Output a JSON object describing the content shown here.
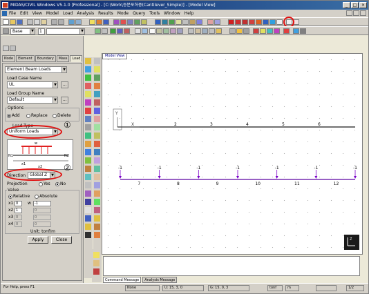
{
  "window": {
    "title": "MIDAS/CIVIL Windows V5.1.0 [Professional] - [C:\\Work\\등분포하중(Cantilever_Simple)] - [Model View]",
    "controls": [
      "_",
      "□",
      "×"
    ]
  },
  "menu": [
    "File",
    "Edit",
    "View",
    "Model",
    "Load",
    "Analysis",
    "Results",
    "Mode",
    "Query",
    "Tools",
    "Window",
    "Help"
  ],
  "toolbar": {
    "unit_system_value": "Base",
    "second_select_value": "1"
  },
  "left_panel": {
    "tabs": [
      "Node",
      "Element",
      "Boundary",
      "Mass",
      "Load"
    ],
    "active_tab": "Load",
    "load_type_select": "Element Beam Loads",
    "load_case_name_label": "Load Case Name",
    "load_case_value": "UL",
    "load_group_name_label": "Load Group Name",
    "load_group_value": "Default",
    "options_label": "Options",
    "options": [
      {
        "label": "Add",
        "selected": true
      },
      {
        "label": "Replace",
        "selected": false
      },
      {
        "label": "Delete",
        "selected": false
      }
    ],
    "load_type_label": "Load Type",
    "load_type_value": "Uniform Loads",
    "diagram_labels": {
      "w": "w",
      "n1": "N1",
      "n2": "N2",
      "x1": "x1",
      "x2": "x2"
    },
    "direction_label": "Direction",
    "direction_value": "Global Z",
    "projection_label": "Projection",
    "projection_options": [
      {
        "label": "Yes",
        "selected": false
      },
      {
        "label": "No",
        "selected": true
      }
    ],
    "value_label": "Value",
    "value_options": [
      {
        "label": "Relative",
        "selected": true
      },
      {
        "label": "Absolute",
        "selected": false
      }
    ],
    "rows": [
      {
        "x": "x1",
        "x_val": "0",
        "w": "w",
        "w_val": "-1"
      },
      {
        "x": "x2",
        "x_val": "1",
        "w": "",
        "w_val": "0"
      },
      {
        "x": "x3",
        "x_val": "0",
        "w": "",
        "w_val": "0"
      },
      {
        "x": "x4",
        "x_val": "0",
        "w": "",
        "w_val": "0"
      }
    ],
    "unit_label": "Unit: tonf/m",
    "apply_label": "Apply",
    "close_label": "Close",
    "annotation_1": "①",
    "annotation_2": "②"
  },
  "model_view": {
    "tab_label": "Model View",
    "top_beam_labels": [
      "1",
      "2",
      "3",
      "4",
      "5",
      "6"
    ],
    "bottom_beam_labels": [
      "7",
      "8",
      "9",
      "10",
      "11",
      "12"
    ],
    "load_marks": [
      "-1",
      "-1",
      "-1",
      "-1",
      "-1",
      "-1",
      "-1"
    ],
    "axis_labels": {
      "y": "Y",
      "x": "X",
      "z": "Z"
    }
  },
  "messages": {
    "tabs": [
      "Command Message",
      "Analysis Message"
    ],
    "active": "Command Message"
  },
  "status": {
    "help": "For Help, press F1",
    "node": "None",
    "u": "U: 15, 3, 0",
    "g": "G: 15, 0, 3",
    "unit1": "tonf",
    "unit2": "m",
    "page": "1/2"
  },
  "colors": {
    "beam_top": "#1a1a1a",
    "load_arrows": "#7a00c8",
    "beam_bottom": "#5a00a0",
    "annotation_red": "#e01010",
    "title_bar": "#0a246a"
  }
}
